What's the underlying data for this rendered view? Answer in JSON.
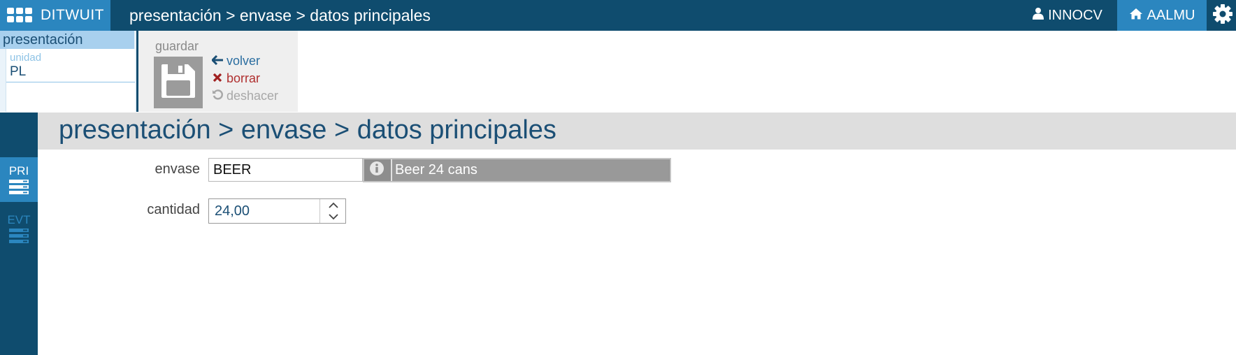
{
  "topbar": {
    "brand": "DITWUIT",
    "title": "presentación > envase > datos principales",
    "user": "INNOCV",
    "home": "AALMU",
    "icons": {
      "apps": "grid-icon",
      "user": "user-icon",
      "home": "home-icon",
      "settings": "gear-icon"
    }
  },
  "presentation_panel": {
    "header": "presentación",
    "unit_label": "unidad",
    "unit_value": "PL"
  },
  "toolbar": {
    "save_label": "guardar",
    "actions": {
      "back": "volver",
      "delete": "borrar",
      "undo": "deshacer"
    }
  },
  "side_nav": {
    "items": [
      {
        "label": "PRI",
        "active": true
      },
      {
        "label": "EVT",
        "active": false
      }
    ]
  },
  "main": {
    "title": "presentación > envase > datos principales",
    "fields": {
      "envase": {
        "label": "envase",
        "value": "BEER",
        "description": "Beer 24 cans"
      },
      "cantidad": {
        "label": "cantidad",
        "value": "24,00"
      }
    }
  },
  "colors": {
    "topbar": "#0f4c6e",
    "accent": "#2b86bf",
    "delete": "#b03030",
    "disabled": "#a8a8a8"
  }
}
